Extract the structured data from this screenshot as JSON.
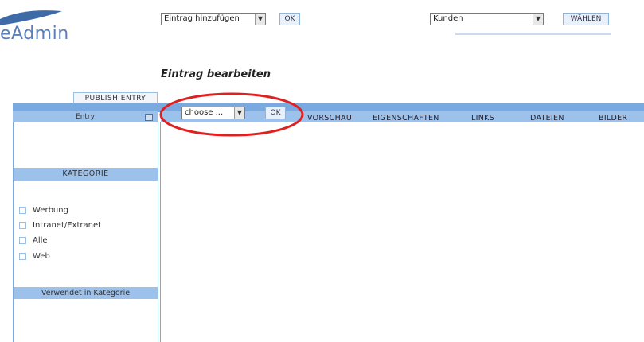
{
  "logo": {
    "text": "eAdmin"
  },
  "header": {
    "entry_select_value": "Eintrag hinzufügen",
    "entry_ok_label": "OK",
    "customer_select_value": "Kunden",
    "choose_button_label": "WÄHLEN"
  },
  "page_title": "Eintrag bearbeiten",
  "publish_tab_label": "PUBLISH ENTRY",
  "left_panel": {
    "entry_header": "Entry",
    "category_header": "KATEGORIE",
    "categories": [
      {
        "label": "Werbung"
      },
      {
        "label": "Intranet/Extranet"
      },
      {
        "label": "Alle"
      },
      {
        "label": "Web"
      }
    ],
    "used_in_header": "Verwendet in Kategorie"
  },
  "toolbar": {
    "choose_select_value": "choose ...",
    "ok_label": "OK"
  },
  "tabs": [
    {
      "label": "VORSCHAU"
    },
    {
      "label": "EIGENSCHAFTEN"
    },
    {
      "label": "LINKS"
    },
    {
      "label": "DATEIEN"
    },
    {
      "label": "BILDER"
    }
  ],
  "colors": {
    "accent_blue": "#7aa9e0",
    "header_blue": "#9cc2ec",
    "highlight_red": "#e02020"
  }
}
